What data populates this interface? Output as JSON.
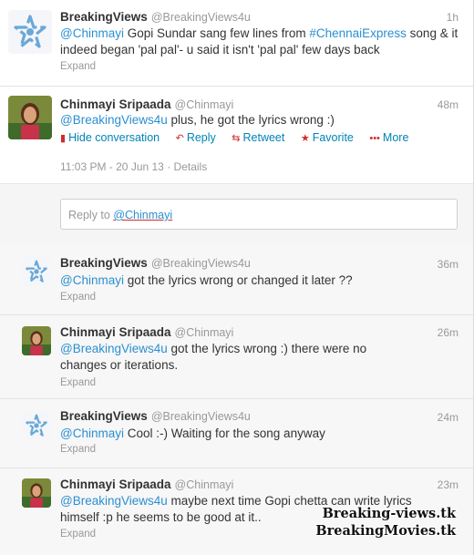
{
  "tweets": [
    {
      "name": "BreakingViews",
      "handle": "@BreakingViews4u",
      "time": "1h",
      "mention": "@Chinmayi",
      "text_a": " Gopi Sundar sang few lines from ",
      "hashtag": "#ChennaiExpress",
      "text_b": " song & it indeed began 'pal pal'- u said it isn't 'pal pal' few days back",
      "expand": "Expand"
    },
    {
      "name": "Chinmayi Sripaada",
      "handle": "@Chinmayi",
      "time": "48m",
      "mention": "@BreakingViews4u",
      "text": " plus, he got the lyrics wrong :)",
      "actions": {
        "hide": "Hide conversation",
        "reply": "Reply",
        "retweet": "Retweet",
        "favorite": "Favorite",
        "more": "More"
      },
      "datetime": "11:03 PM - 20 Jun 13",
      "details": "Details",
      "reply_to": "Reply to",
      "reply_mention": "@Chinmayi"
    },
    {
      "name": "BreakingViews",
      "handle": "@BreakingViews4u",
      "time": "36m",
      "mention": "@Chinmayi",
      "text": " got the lyrics wrong or changed it later ??",
      "expand": "Expand"
    },
    {
      "name": "Chinmayi Sripaada",
      "handle": "@Chinmayi",
      "time": "26m",
      "mention": "@BreakingViews4u",
      "text": " got the lyrics wrong :) there were no changes or iterations.",
      "expand": "Expand"
    },
    {
      "name": "BreakingViews",
      "handle": "@BreakingViews4u",
      "time": "24m",
      "mention": "@Chinmayi",
      "text": " Cool :-) Waiting for the song anyway",
      "expand": "Expand"
    },
    {
      "name": "Chinmayi Sripaada",
      "handle": "@Chinmayi",
      "time": "23m",
      "mention": "@BreakingViews4u",
      "text": " maybe next time Gopi chetta can write lyrics himself :p he seems to be good at it..",
      "expand": "Expand"
    }
  ],
  "watermark": {
    "line1": "Breaking-views.tk",
    "line2": "BreakingMovies.tk"
  },
  "icons": {
    "breakingviews_avatar": "star-logo-icon",
    "chinmayi_avatar": "profile-photo",
    "hide": "speech-bubble-icon",
    "reply": "reply-arrow-icon",
    "retweet": "retweet-icon",
    "favorite": "star-icon",
    "more": "dots-icon"
  },
  "colors": {
    "link": "#2b8fd0",
    "action": "#0084b4",
    "logo": "#6aa8d8"
  }
}
